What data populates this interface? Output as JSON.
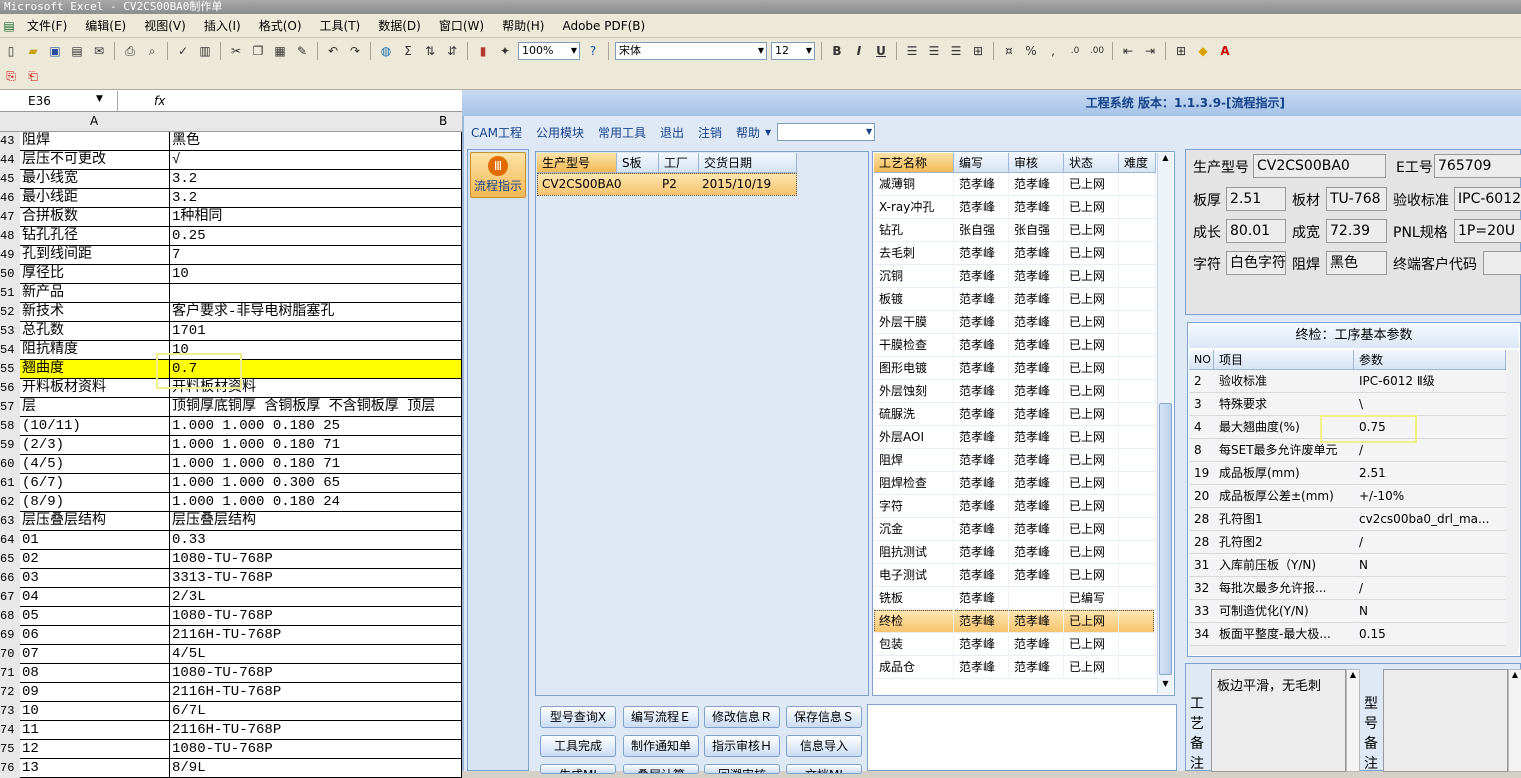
{
  "excel": {
    "title": "Microsoft Excel - CV2CS00BA0制作单",
    "menu": [
      "文件(F)",
      "编辑(E)",
      "视图(V)",
      "插入(I)",
      "格式(O)",
      "工具(T)",
      "数据(D)",
      "窗口(W)",
      "帮助(H)",
      "Adobe PDF(B)"
    ],
    "zoom": "100%",
    "font": "宋体",
    "font_size": "12",
    "namebox": "E36",
    "fx": "fx",
    "col_a": "A",
    "col_b": "B",
    "rows": [
      {
        "n": "43",
        "a": "阻焊",
        "b": "黑色"
      },
      {
        "n": "44",
        "a": "层压不可更改",
        "b": "√"
      },
      {
        "n": "45",
        "a": "最小线宽",
        "b": "3.2"
      },
      {
        "n": "46",
        "a": "最小线距",
        "b": "3.2"
      },
      {
        "n": "47",
        "a": "合拼板数",
        "b": "1种相同"
      },
      {
        "n": "48",
        "a": "钻孔孔径",
        "b": "0.25"
      },
      {
        "n": "49",
        "a": "孔到线间距",
        "b": "7"
      },
      {
        "n": "50",
        "a": "厚径比",
        "b": "10"
      },
      {
        "n": "51",
        "a": "新产品",
        "b": ""
      },
      {
        "n": "52",
        "a": "新技术",
        "b": "客户要求-非导电树脂塞孔"
      },
      {
        "n": "53",
        "a": "总孔数",
        "b": "1701"
      },
      {
        "n": "54",
        "a": "阻抗精度",
        "b": "10"
      },
      {
        "n": "55",
        "a": "翘曲度",
        "b": "0.7",
        "hl": true
      },
      {
        "n": "56",
        "a": "开料板材资料",
        "b": "开料板材资料"
      },
      {
        "n": "57",
        "a": "层",
        "b": "顶铜厚底铜厚 含铜板厚 不含铜板厚 顶层"
      },
      {
        "n": "58",
        "a": "(10/11)",
        "b": "1.000  1.000         0.180      25"
      },
      {
        "n": "59",
        "a": "(2/3)",
        "b": "1.000  1.000         0.180      71"
      },
      {
        "n": "60",
        "a": "(4/5)",
        "b": "1.000  1.000         0.180      71"
      },
      {
        "n": "61",
        "a": "(6/7)",
        "b": "1.000  1.000         0.300      65"
      },
      {
        "n": "62",
        "a": "(8/9)",
        "b": "1.000  1.000         0.180      24"
      },
      {
        "n": "63",
        "a": "层压叠层结构",
        "b": "层压叠层结构"
      },
      {
        "n": "64",
        "a": "01",
        "b": "0.33"
      },
      {
        "n": "65",
        "a": "02",
        "b": "1080-TU-768P"
      },
      {
        "n": "66",
        "a": "03",
        "b": "3313-TU-768P"
      },
      {
        "n": "67",
        "a": "04",
        "b": "2/3L"
      },
      {
        "n": "68",
        "a": "05",
        "b": "1080-TU-768P"
      },
      {
        "n": "69",
        "a": "06",
        "b": "2116H-TU-768P"
      },
      {
        "n": "70",
        "a": "07",
        "b": "4/5L"
      },
      {
        "n": "71",
        "a": "08",
        "b": "1080-TU-768P"
      },
      {
        "n": "72",
        "a": "09",
        "b": "2116H-TU-768P"
      },
      {
        "n": "73",
        "a": "10",
        "b": "6/7L"
      },
      {
        "n": "74",
        "a": "11",
        "b": "2116H-TU-768P"
      },
      {
        "n": "75",
        "a": "12",
        "b": "1080-TU-768P"
      },
      {
        "n": "76",
        "a": "13",
        "b": "8/9L"
      }
    ]
  },
  "eng": {
    "title": "工程系统 版本：1.1.3.9-[流程指示]",
    "menu": [
      "CAM工程",
      "公用模块",
      "常用工具",
      "退出",
      "注销",
      "帮助"
    ],
    "flow_button": "流程指示",
    "order_headers": [
      "生产型号",
      "S板",
      "工厂",
      "交货日期"
    ],
    "order_row": [
      "CV2CS00BA0",
      "",
      "P2",
      "2015/10/19"
    ],
    "process_headers": [
      "工艺名称",
      "编写",
      "审核",
      "状态",
      "难度"
    ],
    "processes": [
      [
        "减薄铜",
        "范孝峰",
        "范孝峰",
        "已上网"
      ],
      [
        "X-ray冲孔",
        "范孝峰",
        "范孝峰",
        "已上网"
      ],
      [
        "钻孔",
        "张自强",
        "张自强",
        "已上网"
      ],
      [
        "去毛刺",
        "范孝峰",
        "范孝峰",
        "已上网"
      ],
      [
        "沉铜",
        "范孝峰",
        "范孝峰",
        "已上网"
      ],
      [
        "板镀",
        "范孝峰",
        "范孝峰",
        "已上网"
      ],
      [
        "外层干膜",
        "范孝峰",
        "范孝峰",
        "已上网"
      ],
      [
        "干膜检查",
        "范孝峰",
        "范孝峰",
        "已上网"
      ],
      [
        "图形电镀",
        "范孝峰",
        "范孝峰",
        "已上网"
      ],
      [
        "外层蚀刻",
        "范孝峰",
        "范孝峰",
        "已上网"
      ],
      [
        "硫脲洗",
        "范孝峰",
        "范孝峰",
        "已上网"
      ],
      [
        "外层AOI",
        "范孝峰",
        "范孝峰",
        "已上网"
      ],
      [
        "阻焊",
        "范孝峰",
        "范孝峰",
        "已上网"
      ],
      [
        "阻焊检查",
        "范孝峰",
        "范孝峰",
        "已上网"
      ],
      [
        "字符",
        "范孝峰",
        "范孝峰",
        "已上网"
      ],
      [
        "沉金",
        "范孝峰",
        "范孝峰",
        "已上网"
      ],
      [
        "阻抗测试",
        "范孝峰",
        "范孝峰",
        "已上网"
      ],
      [
        "电子测试",
        "范孝峰",
        "范孝峰",
        "已上网"
      ],
      [
        "铣板",
        "范孝峰",
        "",
        "已编写"
      ],
      [
        "终检",
        "范孝峰",
        "范孝峰",
        "已上网"
      ],
      [
        "包装",
        "范孝峰",
        "范孝峰",
        "已上网"
      ],
      [
        "成品仓",
        "范孝峰",
        "范孝峰",
        "已上网"
      ]
    ],
    "buttons": [
      "型号查询Ⅹ",
      "编写流程Ｅ",
      "修改信息Ｒ",
      "保存信息Ｓ",
      "工具完成",
      "制作通知单",
      "指示审核Ｈ",
      "信息导入",
      "生成MI",
      "叠层计算",
      "回溯审核",
      "文档MI"
    ],
    "info": {
      "model_label": "生产型号",
      "model": "CV2CS00BA0",
      "e_label": "E工号",
      "e_no": "765709",
      "thick_label": "板厚",
      "thick": "2.51",
      "mat_label": "板材",
      "mat": "TU-768",
      "std_label": "验收标准",
      "std": "IPC-6012",
      "len_label": "成长",
      "len": "80.01",
      "wid_label": "成宽",
      "wid": "72.39",
      "pnl_label": "PNL规格",
      "pnl": "1P=20U",
      "char_label": "字符",
      "char": "白色字符",
      "mask_label": "阻焊",
      "mask": "黑色",
      "cust_label": "终端客户代码",
      "cust": ""
    },
    "params_title": "终检：工序基本参数",
    "params_headers": [
      "NO",
      "项目",
      "参数"
    ],
    "params": [
      [
        "2",
        "验收标准",
        "IPC-6012 Ⅱ级"
      ],
      [
        "3",
        "特殊要求",
        "\\"
      ],
      [
        "4",
        "最大翘曲度(%)",
        "0.75"
      ],
      [
        "8",
        "每SET最多允许废单元",
        "/"
      ],
      [
        "19",
        "成品板厚(mm)",
        "2.51"
      ],
      [
        "20",
        "成品板厚公差±(mm)",
        "+/-10%"
      ],
      [
        "28",
        "孔符图1",
        "cv2cs00ba0_drl_ma..."
      ],
      [
        "28",
        "孔符图2",
        "/"
      ],
      [
        "31",
        "入库前压板（Y/N)",
        "N"
      ],
      [
        "32",
        "每批次最多允许报...",
        "/"
      ],
      [
        "33",
        "可制造优化(Y/N)",
        "N"
      ],
      [
        "34",
        "板面平整度-最大极...",
        "0.15"
      ]
    ],
    "remark_label": "工艺备注",
    "remark": "板边平滑，无毛刺",
    "model_remark_label": "型号备注"
  }
}
